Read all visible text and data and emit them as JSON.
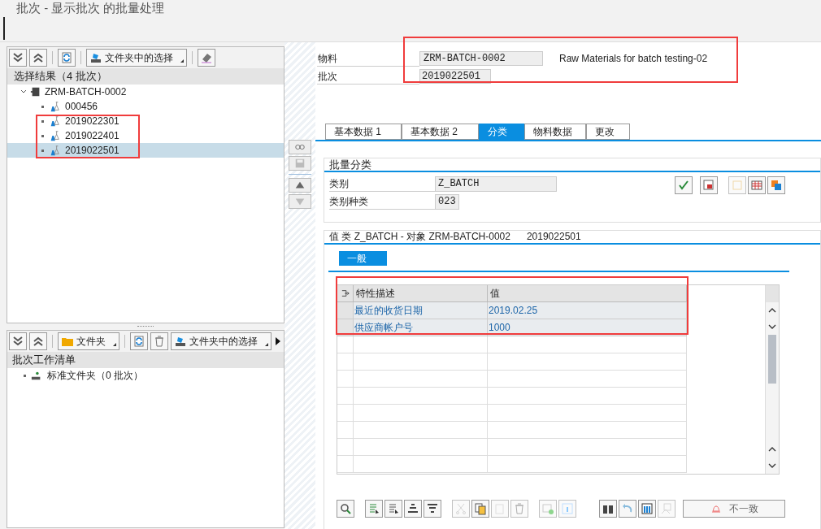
{
  "window": {
    "title": "批次 - 显示批次 的批量处理"
  },
  "selection_panel": {
    "folder_dropdown": "文件夹中的选择",
    "header": "选择结果（4 批次）",
    "tree": [
      {
        "label": "ZRM-BATCH-0002",
        "expanded": true,
        "children": [
          {
            "label": "000456",
            "selected": false
          },
          {
            "label": "2019022301",
            "selected": false
          },
          {
            "label": "2019022401",
            "selected": false
          },
          {
            "label": "2019022501",
            "selected": true
          }
        ]
      }
    ]
  },
  "worklist_panel": {
    "folder_dropdown": "文件夹",
    "selection_dropdown": "文件夹中的选择",
    "header": "批次工作清单",
    "items": [
      {
        "label": "标准文件夹（0 批次）"
      }
    ]
  },
  "header": {
    "material_label": "物料",
    "material": "ZRM-BATCH-0002",
    "material_description": "Raw Materials for batch testing-02",
    "batch_label": "批次",
    "batch": "2019022501"
  },
  "tabs": [
    {
      "label": "基本数据 1",
      "selected": false
    },
    {
      "label": "基本数据 2",
      "selected": false
    },
    {
      "label": "分类",
      "selected": true
    },
    {
      "label": "物料数据",
      "selected": false
    },
    {
      "label": "更改",
      "selected": false
    }
  ],
  "classification": {
    "title": "批量分类",
    "fields": [
      {
        "label": "类别",
        "value": "Z_BATCH"
      },
      {
        "label": "类别种类",
        "value": "023"
      }
    ]
  },
  "values": {
    "title": "值 类 Z_BATCH - 对象 ZRM-BATCH-0002",
    "batch": "2019022501",
    "subtabs": [
      {
        "label": "一般",
        "selected": true
      }
    ],
    "table": {
      "columns": [
        "特性描述",
        "值"
      ],
      "rows": [
        [
          "最近的收货日期",
          "2019.02.25"
        ],
        [
          "供应商帐户号",
          "1000"
        ]
      ]
    },
    "inconsistent_button": "不一致"
  }
}
